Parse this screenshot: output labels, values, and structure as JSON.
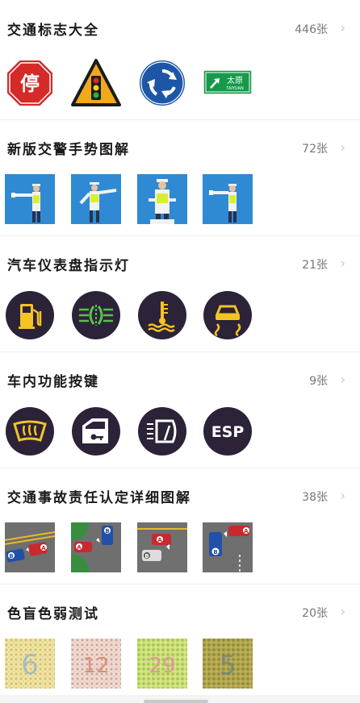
{
  "sections": [
    {
      "title": "交通标志大全",
      "count": "446张",
      "items": [
        {
          "icon": "stop-sign"
        },
        {
          "icon": "traffic-light-warning-sign"
        },
        {
          "icon": "roundabout-sign"
        },
        {
          "icon": "direction-sign",
          "text": "太原",
          "subtext": "TAIYUAN"
        }
      ]
    },
    {
      "title": "新版交警手势图解",
      "count": "72张",
      "items": [
        {
          "icon": "police-gesture-1"
        },
        {
          "icon": "police-gesture-2"
        },
        {
          "icon": "police-gesture-3"
        },
        {
          "icon": "police-gesture-4"
        }
      ]
    },
    {
      "title": "汽车仪表盘指示灯",
      "count": "21张",
      "items": [
        {
          "icon": "fuel-icon"
        },
        {
          "icon": "fog-light-icon"
        },
        {
          "icon": "coolant-temp-icon"
        },
        {
          "icon": "traction-control-icon"
        }
      ]
    },
    {
      "title": "车内功能按键",
      "count": "9张",
      "items": [
        {
          "icon": "defroster-icon"
        },
        {
          "icon": "door-lock-icon"
        },
        {
          "icon": "wiper-icon"
        },
        {
          "icon": "esp-icon",
          "text": "ESP"
        }
      ]
    },
    {
      "title": "交通事故责任认定详细图解",
      "count": "38张",
      "items": [
        {
          "icon": "accident-1",
          "labels": [
            "B",
            "A"
          ]
        },
        {
          "icon": "accident-2",
          "labels": [
            "A",
            "B"
          ]
        },
        {
          "icon": "accident-3",
          "labels": [
            "A",
            "B"
          ]
        },
        {
          "icon": "accident-4",
          "labels": [
            "B",
            "A"
          ]
        }
      ]
    },
    {
      "title": "色盲色弱测试",
      "count": "20张",
      "items": [
        {
          "icon": "color-plate-1",
          "text": "6"
        },
        {
          "icon": "color-plate-2",
          "text": "12"
        },
        {
          "icon": "color-plate-3",
          "text": "29"
        },
        {
          "icon": "color-plate-4",
          "text": "5"
        }
      ]
    }
  ],
  "colors": {
    "accent_green": "#169a4a",
    "dash_bg": "#2c2338",
    "dash_yellow": "#f6c324",
    "dash_green": "#5ac04e",
    "police_blue": "#2f8ad3",
    "chevron": "#c8c8c8"
  }
}
